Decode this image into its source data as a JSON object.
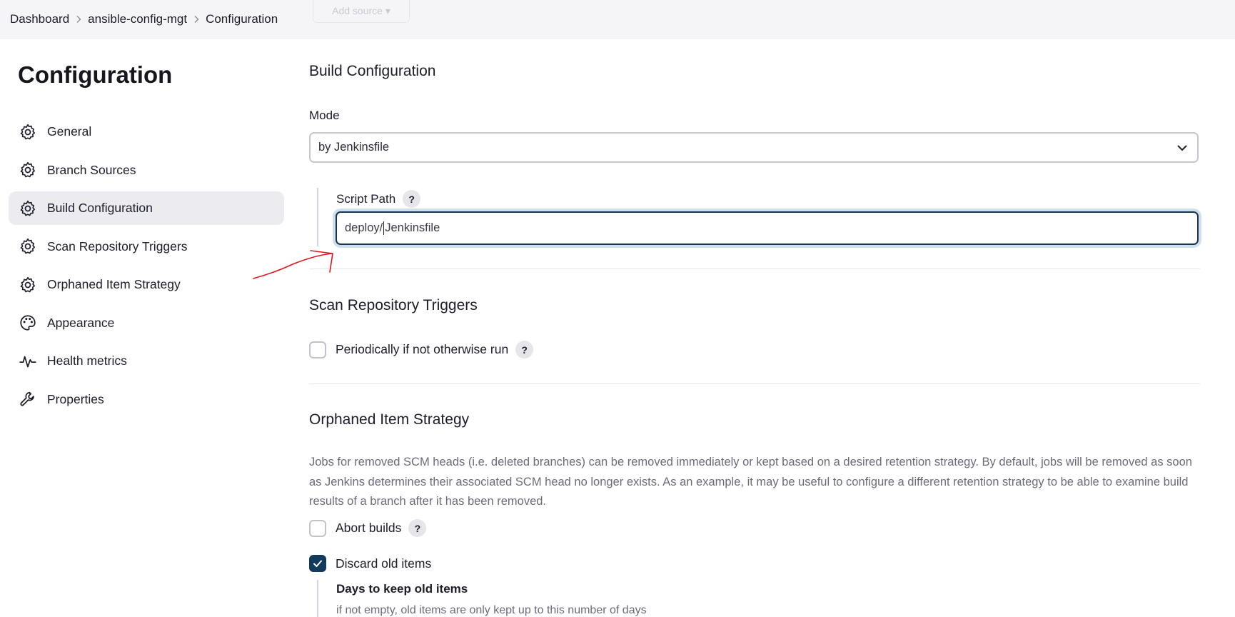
{
  "breadcrumb": {
    "items": [
      "Dashboard",
      "ansible-config-mgt",
      "Configuration"
    ],
    "ghost_button": "Add source ▾"
  },
  "sidebar": {
    "title": "Configuration",
    "items": [
      {
        "label": "General",
        "icon": "gear-icon"
      },
      {
        "label": "Branch Sources",
        "icon": "gear-icon"
      },
      {
        "label": "Build Configuration",
        "icon": "gear-icon",
        "active": true
      },
      {
        "label": "Scan Repository Triggers",
        "icon": "gear-icon"
      },
      {
        "label": "Orphaned Item Strategy",
        "icon": "gear-icon"
      },
      {
        "label": "Appearance",
        "icon": "palette-icon"
      },
      {
        "label": "Health metrics",
        "icon": "pulse-icon"
      },
      {
        "label": "Properties",
        "icon": "wrench-icon"
      }
    ]
  },
  "build_config": {
    "title": "Build Configuration",
    "mode_label": "Mode",
    "mode_value": "by Jenkinsfile",
    "script_path_label": "Script Path",
    "script_path_value_before_caret": "deploy/",
    "script_path_value_after_caret": "Jenkinsfile",
    "help": "?"
  },
  "scan_triggers": {
    "title": "Scan Repository Triggers",
    "periodic_label": "Periodically if not otherwise run",
    "periodic_checked": false
  },
  "orphaned": {
    "title": "Orphaned Item Strategy",
    "description": "Jobs for removed SCM heads (i.e. deleted branches) can be removed immediately or kept based on a desired retention strategy. By default, jobs will be removed as soon as Jenkins determines their associated SCM head no longer exists. As an example, it may be useful to configure a different retention strategy to be able to examine build results of a branch after it has been removed.",
    "abort_label": "Abort builds",
    "abort_checked": false,
    "discard_label": "Discard old items",
    "discard_checked": true,
    "days_label": "Days to keep old items",
    "days_hint": "if not empty, old items are only kept up to this number of days"
  },
  "colors": {
    "accent": "#123a5c",
    "annotation": "#e0141e"
  }
}
